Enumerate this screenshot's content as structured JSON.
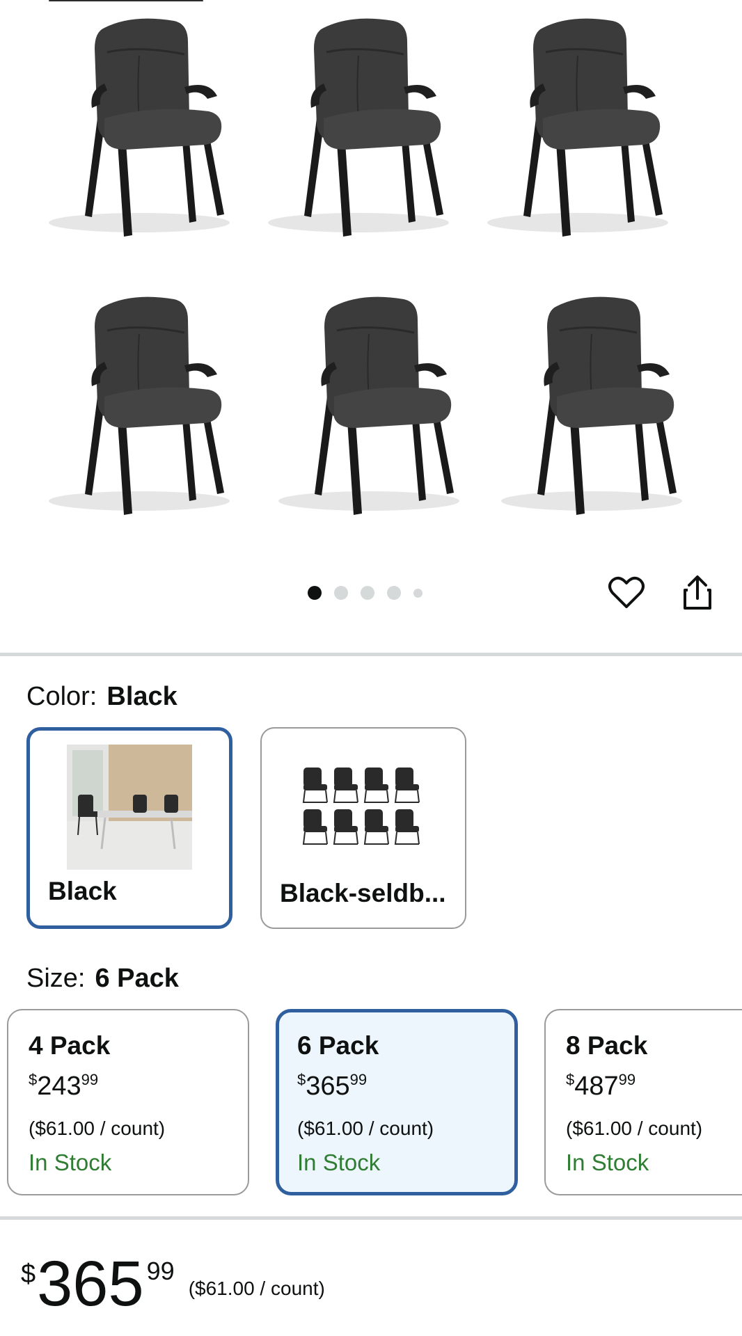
{
  "gallery": {
    "image_count": 6,
    "pagination": {
      "total": 5,
      "active_index": 0
    },
    "actions": {
      "favorite_icon": "heart-icon",
      "share_icon": "share-icon"
    }
  },
  "color": {
    "label": "Color:",
    "selected": "Black",
    "options": [
      {
        "label": "Black",
        "selected": true
      },
      {
        "label": "Black-seldb...",
        "selected": false
      }
    ]
  },
  "size": {
    "label": "Size:",
    "selected": "6 Pack",
    "options": [
      {
        "name": "4 Pack",
        "currency": "$",
        "whole": "243",
        "fraction": "99",
        "unit_price": "($61.00 / count)",
        "stock": "In Stock",
        "selected": false
      },
      {
        "name": "6 Pack",
        "currency": "$",
        "whole": "365",
        "fraction": "99",
        "unit_price": "($61.00 / count)",
        "stock": "In Stock",
        "selected": true
      },
      {
        "name": "8 Pack",
        "currency": "$",
        "whole": "487",
        "fraction": "99",
        "unit_price": "($61.00 / count)",
        "stock": "In Stock",
        "selected": false
      }
    ]
  },
  "price": {
    "currency": "$",
    "whole": "365",
    "fraction": "99",
    "unit_price": "($61.00 / count)"
  },
  "colors": {
    "selected_border": "#2f5f9f",
    "selected_fill": "#edf6fd",
    "in_stock": "#2f7d32",
    "divider": "#d5d9d9"
  }
}
